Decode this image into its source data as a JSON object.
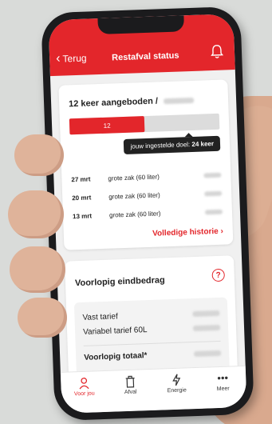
{
  "header": {
    "back_label": "Terug",
    "title": "Restafval status"
  },
  "offer_card": {
    "count_label": "12 keer aangeboden /",
    "progress": {
      "value": "12",
      "goal": 24,
      "fraction": 0.5
    },
    "goal_text": "jouw ingestelde doel:",
    "goal_value": "24 keer",
    "history": [
      {
        "date": "27 mrt",
        "desc": "grote zak (60 liter)"
      },
      {
        "date": "20 mrt",
        "desc": "grote zak (60 liter)"
      },
      {
        "date": "13 mrt",
        "desc": "grote zak (60 liter)"
      }
    ],
    "history_link": "Volledige historie"
  },
  "estimate_card": {
    "title": "Voorlopig eindbedrag",
    "help_icon": "?",
    "rows": [
      {
        "label": "Vast tarief"
      },
      {
        "label": "Variabel tarief 60L"
      }
    ],
    "total_label": "Voorlopig totaal*"
  },
  "tabs": [
    {
      "label": "Voor jou",
      "icon": "person-icon",
      "active": true
    },
    {
      "label": "Afval",
      "icon": "trash-icon",
      "active": false
    },
    {
      "label": "Energie",
      "icon": "lightning-icon",
      "active": false
    },
    {
      "label": "Meer",
      "icon": "more-icon",
      "active": false
    }
  ],
  "colors": {
    "accent": "#e3262b",
    "tooltip": "#222222"
  }
}
